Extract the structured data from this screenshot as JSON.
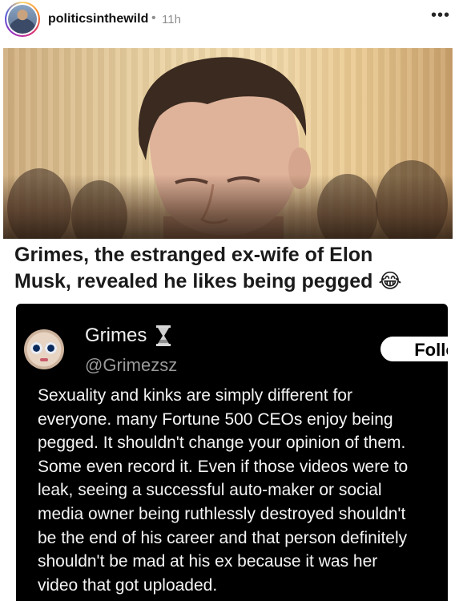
{
  "post": {
    "username": "politicsinthewild",
    "separator": "•",
    "time": "11h",
    "more_icon": "more-horizontal-icon"
  },
  "headline": {
    "line1": "Grimes, the estranged ex-wife of Elon",
    "line2": "Musk, revealed he likes being pegged 😂"
  },
  "tweet": {
    "name": "Grimes",
    "name_icon": "hourglass-icon",
    "handle": "@Grimezsz",
    "follow_label": "Follo",
    "lines": [
      "Sexuality and kinks are simply different for",
      "everyone. many Fortune 500 CEOs enjoy being",
      "pegged. It shouldn't change your opinion of them.",
      "Some even record it. Even if those videos were to",
      "leak, seeing a successful auto-maker or social",
      "media owner being ruthlessly destroyed shouldn't",
      "be the end of his career and that person definitely",
      "shouldn't be mad at his ex because it was her",
      "video that got uploaded."
    ]
  },
  "colors": {
    "tweet_background": "#000000",
    "handle_gray": "#9a9a9a",
    "meta_gray": "#8e8e8e"
  }
}
